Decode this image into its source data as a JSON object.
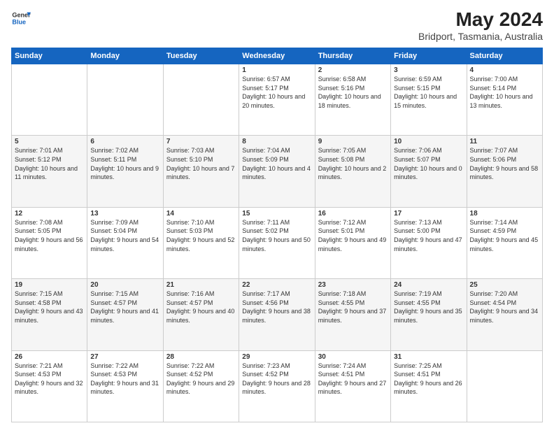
{
  "header": {
    "logo_line1": "General",
    "logo_line2": "Blue",
    "title": "May 2024",
    "subtitle": "Bridport, Tasmania, Australia"
  },
  "days_of_week": [
    "Sunday",
    "Monday",
    "Tuesday",
    "Wednesday",
    "Thursday",
    "Friday",
    "Saturday"
  ],
  "weeks": [
    [
      {
        "day": "",
        "sunrise": "",
        "sunset": "",
        "daylight": ""
      },
      {
        "day": "",
        "sunrise": "",
        "sunset": "",
        "daylight": ""
      },
      {
        "day": "",
        "sunrise": "",
        "sunset": "",
        "daylight": ""
      },
      {
        "day": "1",
        "sunrise": "Sunrise: 6:57 AM",
        "sunset": "Sunset: 5:17 PM",
        "daylight": "Daylight: 10 hours and 20 minutes."
      },
      {
        "day": "2",
        "sunrise": "Sunrise: 6:58 AM",
        "sunset": "Sunset: 5:16 PM",
        "daylight": "Daylight: 10 hours and 18 minutes."
      },
      {
        "day": "3",
        "sunrise": "Sunrise: 6:59 AM",
        "sunset": "Sunset: 5:15 PM",
        "daylight": "Daylight: 10 hours and 15 minutes."
      },
      {
        "day": "4",
        "sunrise": "Sunrise: 7:00 AM",
        "sunset": "Sunset: 5:14 PM",
        "daylight": "Daylight: 10 hours and 13 minutes."
      }
    ],
    [
      {
        "day": "5",
        "sunrise": "Sunrise: 7:01 AM",
        "sunset": "Sunset: 5:12 PM",
        "daylight": "Daylight: 10 hours and 11 minutes."
      },
      {
        "day": "6",
        "sunrise": "Sunrise: 7:02 AM",
        "sunset": "Sunset: 5:11 PM",
        "daylight": "Daylight: 10 hours and 9 minutes."
      },
      {
        "day": "7",
        "sunrise": "Sunrise: 7:03 AM",
        "sunset": "Sunset: 5:10 PM",
        "daylight": "Daylight: 10 hours and 7 minutes."
      },
      {
        "day": "8",
        "sunrise": "Sunrise: 7:04 AM",
        "sunset": "Sunset: 5:09 PM",
        "daylight": "Daylight: 10 hours and 4 minutes."
      },
      {
        "day": "9",
        "sunrise": "Sunrise: 7:05 AM",
        "sunset": "Sunset: 5:08 PM",
        "daylight": "Daylight: 10 hours and 2 minutes."
      },
      {
        "day": "10",
        "sunrise": "Sunrise: 7:06 AM",
        "sunset": "Sunset: 5:07 PM",
        "daylight": "Daylight: 10 hours and 0 minutes."
      },
      {
        "day": "11",
        "sunrise": "Sunrise: 7:07 AM",
        "sunset": "Sunset: 5:06 PM",
        "daylight": "Daylight: 9 hours and 58 minutes."
      }
    ],
    [
      {
        "day": "12",
        "sunrise": "Sunrise: 7:08 AM",
        "sunset": "Sunset: 5:05 PM",
        "daylight": "Daylight: 9 hours and 56 minutes."
      },
      {
        "day": "13",
        "sunrise": "Sunrise: 7:09 AM",
        "sunset": "Sunset: 5:04 PM",
        "daylight": "Daylight: 9 hours and 54 minutes."
      },
      {
        "day": "14",
        "sunrise": "Sunrise: 7:10 AM",
        "sunset": "Sunset: 5:03 PM",
        "daylight": "Daylight: 9 hours and 52 minutes."
      },
      {
        "day": "15",
        "sunrise": "Sunrise: 7:11 AM",
        "sunset": "Sunset: 5:02 PM",
        "daylight": "Daylight: 9 hours and 50 minutes."
      },
      {
        "day": "16",
        "sunrise": "Sunrise: 7:12 AM",
        "sunset": "Sunset: 5:01 PM",
        "daylight": "Daylight: 9 hours and 49 minutes."
      },
      {
        "day": "17",
        "sunrise": "Sunrise: 7:13 AM",
        "sunset": "Sunset: 5:00 PM",
        "daylight": "Daylight: 9 hours and 47 minutes."
      },
      {
        "day": "18",
        "sunrise": "Sunrise: 7:14 AM",
        "sunset": "Sunset: 4:59 PM",
        "daylight": "Daylight: 9 hours and 45 minutes."
      }
    ],
    [
      {
        "day": "19",
        "sunrise": "Sunrise: 7:15 AM",
        "sunset": "Sunset: 4:58 PM",
        "daylight": "Daylight: 9 hours and 43 minutes."
      },
      {
        "day": "20",
        "sunrise": "Sunrise: 7:15 AM",
        "sunset": "Sunset: 4:57 PM",
        "daylight": "Daylight: 9 hours and 41 minutes."
      },
      {
        "day": "21",
        "sunrise": "Sunrise: 7:16 AM",
        "sunset": "Sunset: 4:57 PM",
        "daylight": "Daylight: 9 hours and 40 minutes."
      },
      {
        "day": "22",
        "sunrise": "Sunrise: 7:17 AM",
        "sunset": "Sunset: 4:56 PM",
        "daylight": "Daylight: 9 hours and 38 minutes."
      },
      {
        "day": "23",
        "sunrise": "Sunrise: 7:18 AM",
        "sunset": "Sunset: 4:55 PM",
        "daylight": "Daylight: 9 hours and 37 minutes."
      },
      {
        "day": "24",
        "sunrise": "Sunrise: 7:19 AM",
        "sunset": "Sunset: 4:55 PM",
        "daylight": "Daylight: 9 hours and 35 minutes."
      },
      {
        "day": "25",
        "sunrise": "Sunrise: 7:20 AM",
        "sunset": "Sunset: 4:54 PM",
        "daylight": "Daylight: 9 hours and 34 minutes."
      }
    ],
    [
      {
        "day": "26",
        "sunrise": "Sunrise: 7:21 AM",
        "sunset": "Sunset: 4:53 PM",
        "daylight": "Daylight: 9 hours and 32 minutes."
      },
      {
        "day": "27",
        "sunrise": "Sunrise: 7:22 AM",
        "sunset": "Sunset: 4:53 PM",
        "daylight": "Daylight: 9 hours and 31 minutes."
      },
      {
        "day": "28",
        "sunrise": "Sunrise: 7:22 AM",
        "sunset": "Sunset: 4:52 PM",
        "daylight": "Daylight: 9 hours and 29 minutes."
      },
      {
        "day": "29",
        "sunrise": "Sunrise: 7:23 AM",
        "sunset": "Sunset: 4:52 PM",
        "daylight": "Daylight: 9 hours and 28 minutes."
      },
      {
        "day": "30",
        "sunrise": "Sunrise: 7:24 AM",
        "sunset": "Sunset: 4:51 PM",
        "daylight": "Daylight: 9 hours and 27 minutes."
      },
      {
        "day": "31",
        "sunrise": "Sunrise: 7:25 AM",
        "sunset": "Sunset: 4:51 PM",
        "daylight": "Daylight: 9 hours and 26 minutes."
      },
      {
        "day": "",
        "sunrise": "",
        "sunset": "",
        "daylight": ""
      }
    ]
  ]
}
